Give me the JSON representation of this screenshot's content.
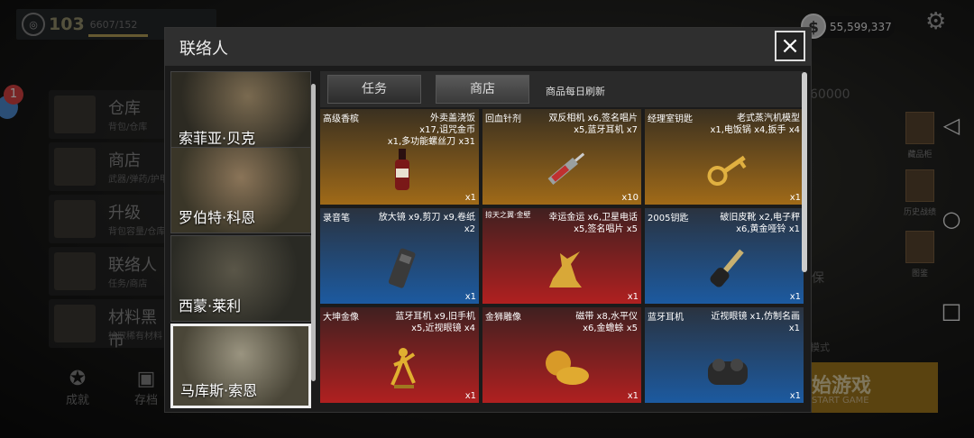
{
  "player": {
    "level": "103",
    "xp": "6607/152"
  },
  "left_menu": [
    {
      "title": "仓库",
      "sub": "背包/仓库"
    },
    {
      "title": "商店",
      "sub": "武器/弹药/护甲"
    },
    {
      "title": "升级",
      "sub": "背包容量/仓库"
    },
    {
      "title": "联络人",
      "sub": "任务/商店"
    },
    {
      "title": "材料黑市",
      "sub": "抽取稀有材料"
    }
  ],
  "notification_count": "1",
  "bottom_bar": {
    "achievements": "成就",
    "save": "存档"
  },
  "money": "55,599,337",
  "right_side": {
    "collection": "藏品柜",
    "history": "历史战绩",
    "archive": "图鉴",
    "partial_number": "60000",
    "partial_save": "保",
    "partial_mode": "模式",
    "start_title": "始游戏",
    "start_sub": "START GAME"
  },
  "modal": {
    "title": "联络人",
    "close_symbol": "×",
    "contacts": [
      "索菲亚·贝克",
      "罗伯特·科恩",
      "西蒙·莱利",
      "马库斯·索恩"
    ],
    "selected_contact": "马库斯·索恩",
    "tabs": [
      "任务",
      "商店"
    ],
    "active_tab": "商店",
    "refresh_note": "商品每日刷新",
    "items": [
      {
        "name": "高级香槟",
        "req": "外卖盖浇饭\nx17,诅咒金币\nx1,多功能螺丝刀 x31",
        "qty": "x1",
        "theme": "gold",
        "icon": "champagne-icon"
      },
      {
        "name": "回血针剂",
        "req": "双反相机 x6,签名唱片\nx5,蓝牙耳机 x7",
        "qty": "x10",
        "theme": "gold",
        "icon": "syringe-icon"
      },
      {
        "name": "经理室钥匙",
        "req": "老式蒸汽机模型\nx1,电饭锅 x4,扳手 x4",
        "qty": "x1",
        "theme": "gold",
        "icon": "key-icon"
      },
      {
        "name": "录音笔",
        "req": "放大镜 x9,剪刀 x9,卷纸\nx2",
        "qty": "x1",
        "theme": "blue",
        "icon": "recorder-icon"
      },
      {
        "name": "掠天之翼·金壁",
        "req": "幸运金运 x6,卫星电话\nx5,签名唱片 x5",
        "qty": "x1",
        "theme": "red",
        "icon": "dragon-icon"
      },
      {
        "name": "2005钥匙",
        "req": "破旧皮靴 x2,电子秤\nx6,黄金哑铃 x1",
        "qty": "x1",
        "theme": "blue",
        "icon": "car-key-icon"
      },
      {
        "name": "大坤金像",
        "req": "蓝牙耳机 x9,旧手机\nx5,近视眼镜 x4",
        "qty": "x1",
        "theme": "red",
        "icon": "statue-icon"
      },
      {
        "name": "金狮雕像",
        "req": "磁带 x8,水平仪\nx6,金蟾蜍 x5",
        "qty": "x1",
        "theme": "red",
        "icon": "lion-icon"
      },
      {
        "name": "蓝牙耳机",
        "req": "近视眼镜 x1,仿制名画\nx1",
        "qty": "x1",
        "theme": "blue",
        "icon": "earbuds-icon"
      }
    ]
  }
}
